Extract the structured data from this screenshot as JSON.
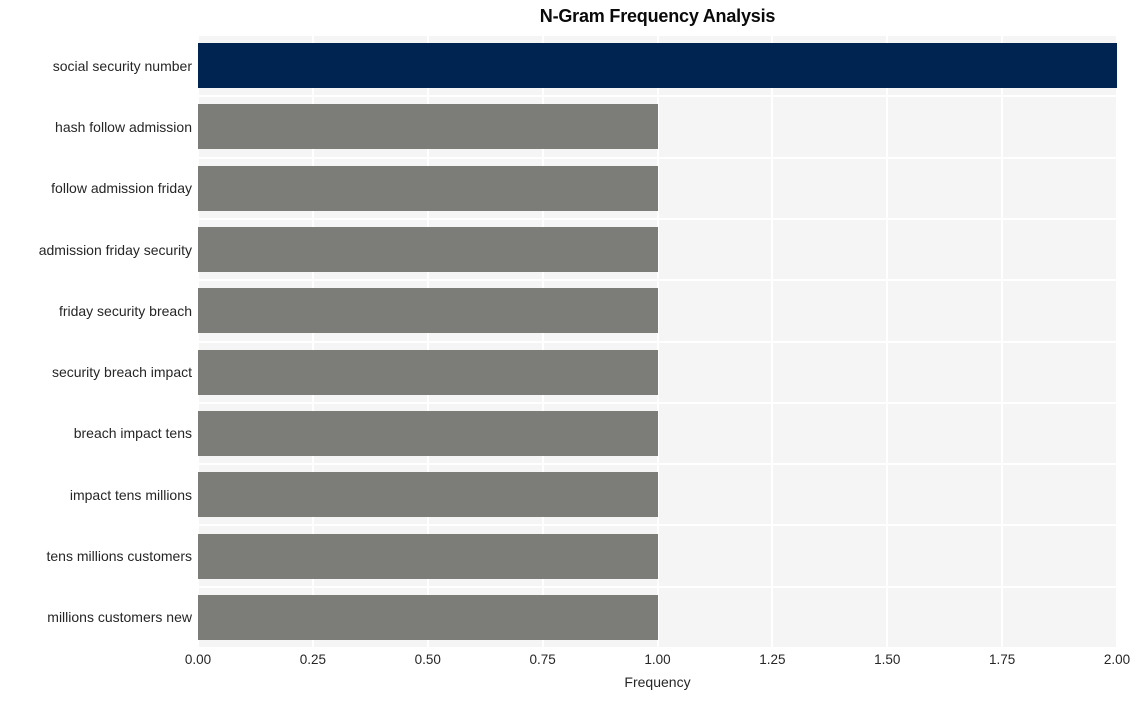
{
  "chart_data": {
    "type": "bar",
    "orientation": "horizontal",
    "title": "N-Gram Frequency Analysis",
    "xlabel": "Frequency",
    "ylabel": "",
    "categories": [
      "social security number",
      "hash follow admission",
      "follow admission friday",
      "admission friday security",
      "friday security breach",
      "security breach impact",
      "breach impact tens",
      "impact tens millions",
      "tens millions customers",
      "millions customers new"
    ],
    "values": [
      2,
      1,
      1,
      1,
      1,
      1,
      1,
      1,
      1,
      1
    ],
    "xlim": [
      0,
      2.0
    ],
    "xticks": [
      0,
      0.25,
      0.5,
      0.75,
      1.0,
      1.25,
      1.5,
      1.75,
      2.0
    ],
    "xtick_labels": [
      "0.00",
      "0.25",
      "0.50",
      "0.75",
      "1.00",
      "1.25",
      "1.50",
      "1.75",
      "2.00"
    ],
    "grid": true,
    "legend": null,
    "bar_colors": [
      "#002451",
      "#7c7c79",
      "#7c7c79",
      "#7c7c79",
      "#7c7c79",
      "#7c7c79",
      "#7c7c79",
      "#7c7c79",
      "#7c7c79",
      "#7c7c79"
    ],
    "highlight_color": "#002451",
    "default_color": "#7c7c79",
    "plot_background": "#f5f5f6",
    "grid_color": "#ffffff",
    "figure_background": "#ffffff",
    "text_color": "#262626"
  }
}
